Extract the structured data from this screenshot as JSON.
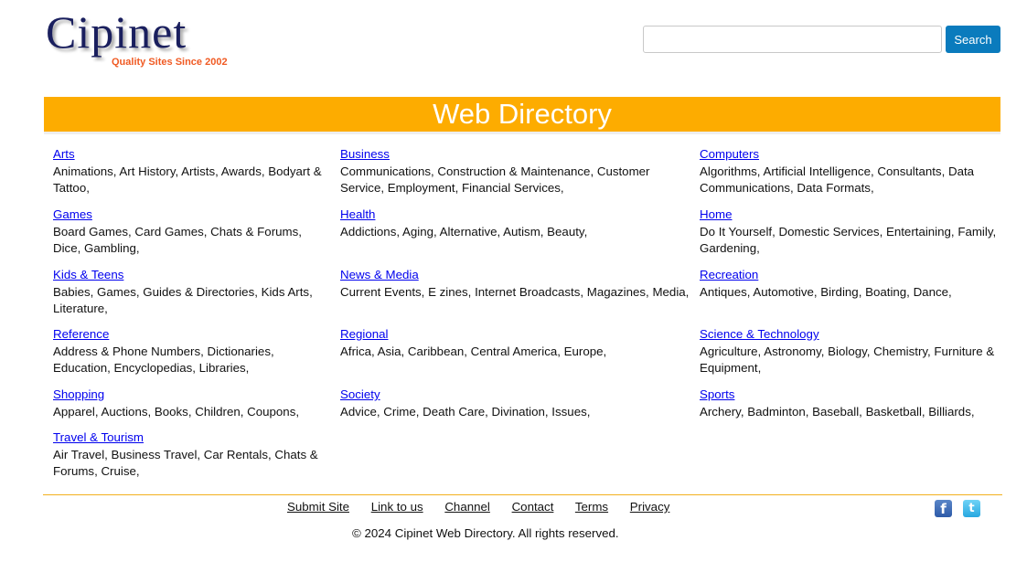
{
  "header": {
    "logo_text": "Cipinet",
    "logo_tagline": "Quality Sites Since 2002",
    "search_placeholder": "",
    "search_value": "",
    "search_button": "Search"
  },
  "banner": {
    "title": "Web Directory"
  },
  "colors": {
    "banner": "#fdac00",
    "search_button": "#0a7bbd",
    "tagline": "#f05a23",
    "link": "#0000ee",
    "footer_line": "#f2b01e"
  },
  "categories": [
    {
      "name": "Arts",
      "subs": "Animations, Art History, Artists, Awards, Bodyart & Tattoo,"
    },
    {
      "name": "Business",
      "subs": "Communications, Construction & Maintenance, Customer Service, Employment, Financial Services,"
    },
    {
      "name": "Computers",
      "subs": "Algorithms, Artificial Intelligence, Consultants, Data Communications, Data Formats,"
    },
    {
      "name": "Games",
      "subs": "Board Games, Card Games, Chats & Forums, Dice, Gambling,"
    },
    {
      "name": "Health",
      "subs": "Addictions, Aging, Alternative, Autism, Beauty,"
    },
    {
      "name": "Home",
      "subs": "Do It Yourself, Domestic Services, Entertaining, Family, Gardening,"
    },
    {
      "name": "Kids & Teens",
      "subs": "Babies, Games, Guides & Directories, Kids Arts, Literature,"
    },
    {
      "name": "News & Media",
      "subs": "Current Events, E zines, Internet Broadcasts, Magazines, Media,"
    },
    {
      "name": "Recreation",
      "subs": "Antiques, Automotive, Birding, Boating, Dance,"
    },
    {
      "name": "Reference",
      "subs": "Address & Phone Numbers, Dictionaries, Education, Encyclopedias, Libraries,"
    },
    {
      "name": "Regional",
      "subs": "Africa, Asia, Caribbean, Central America, Europe,"
    },
    {
      "name": "Science & Technology",
      "subs": "Agriculture, Astronomy, Biology, Chemistry, Furniture & Equipment,"
    },
    {
      "name": "Shopping",
      "subs": "Apparel, Auctions, Books, Children, Coupons,"
    },
    {
      "name": "Society",
      "subs": "Advice, Crime, Death Care, Divination, Issues,"
    },
    {
      "name": "Sports",
      "subs": "Archery, Badminton, Baseball, Basketball, Billiards,"
    },
    {
      "name": "Travel & Tourism",
      "subs": "Air Travel, Business Travel, Car Rentals, Chats & Forums, Cruise,"
    }
  ],
  "footer": {
    "links": [
      "Submit Site",
      "Link to us",
      "Channel",
      "Contact",
      "Terms",
      "Privacy"
    ],
    "copyright": "© 2024 Cipinet Web Directory. All rights reserved.",
    "social": [
      "facebook-icon",
      "twitter-icon"
    ]
  }
}
